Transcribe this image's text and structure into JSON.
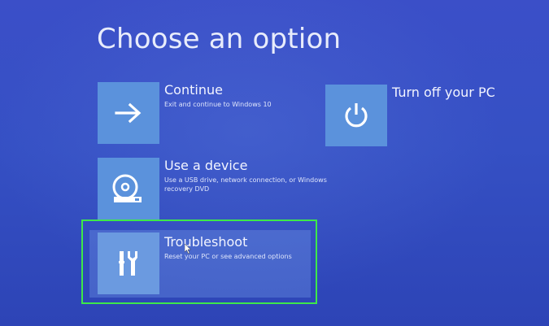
{
  "page": {
    "title": "Choose an option"
  },
  "options": {
    "continue": {
      "label": "Continue",
      "description": "Exit and continue to Windows 10",
      "icon": "arrow-right-icon"
    },
    "use_device": {
      "label": "Use a device",
      "description": "Use a USB drive, network connection, or Windows recovery DVD",
      "icon": "disc-drive-icon"
    },
    "turn_off": {
      "label": "Turn off your PC",
      "icon": "power-icon"
    },
    "troubleshoot": {
      "label": "Troubleshoot",
      "description": "Reset your PC or see advanced options",
      "icon": "tools-icon"
    }
  },
  "colors": {
    "background": "#3550c4",
    "tile": "#5b92dc",
    "highlight": "#3ee84a"
  }
}
